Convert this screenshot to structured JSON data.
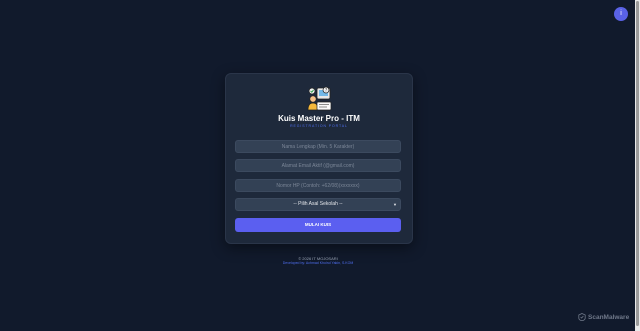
{
  "fab": {
    "icon": "info-icon",
    "glyph": "i"
  },
  "card": {
    "title": "Kuis Master Pro - ITM",
    "subtitle": "REGISTRATION PORTAL",
    "logo_icon": "quiz-master-logo-icon"
  },
  "form": {
    "name_placeholder": "Nama Lengkap (Min. 5 Karakter)",
    "email_placeholder": "Alamat Email Aktif (@gmail.com)",
    "phone_placeholder": "Nomor HP (Contoh: +62/08)(xxxxxxx)",
    "school_select_value": "-- Pilih Asal Sekolah --",
    "submit_label": "MULAI KUIS"
  },
  "footer": {
    "copyright": "© 2026 IT MOJOSARI",
    "developer": "Developed by: Achmad Khoirul Yakin, S.KOM"
  },
  "watermark": {
    "text": "ScanMalware",
    "icon": "scanmalware-logo-icon"
  },
  "colors": {
    "background": "#111a2c",
    "card": "#1e293b",
    "input": "#334155",
    "accent": "#5b5ff0",
    "subtitle": "#4f6ff0"
  }
}
